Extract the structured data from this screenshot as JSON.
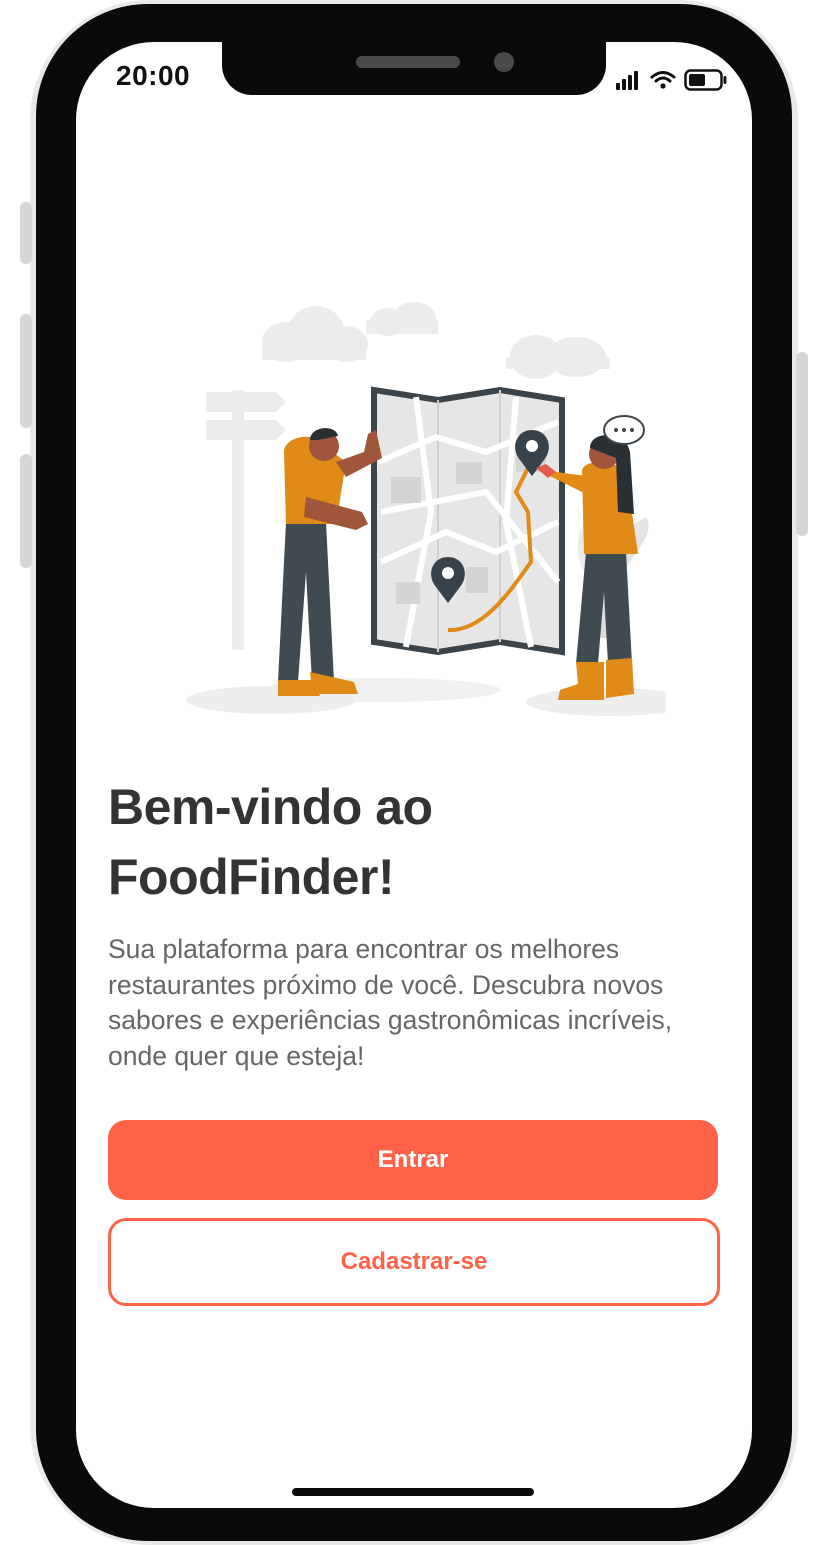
{
  "status_bar": {
    "time": "20:00",
    "icons": [
      "signal-icon",
      "wifi-icon",
      "battery-icon"
    ]
  },
  "illustration": {
    "name": "map-illustration",
    "description_icon": "people-with-map-icon"
  },
  "welcome": {
    "title_line1": "Bem-vindo ao",
    "title_line2": "FoodFinder!",
    "subtitle": "Sua plataforma para encontrar os melhores restaurantes próximo de você. Descubra novos sabores e experiências gastronômicas incríveis, onde quer que esteja!"
  },
  "actions": {
    "login_label": "Entrar",
    "signup_label": "Cadastrar-se"
  },
  "colors": {
    "accent": "#ff6347",
    "title": "#333333",
    "body_text": "#666666",
    "illustration_orange": "#e08a17"
  }
}
